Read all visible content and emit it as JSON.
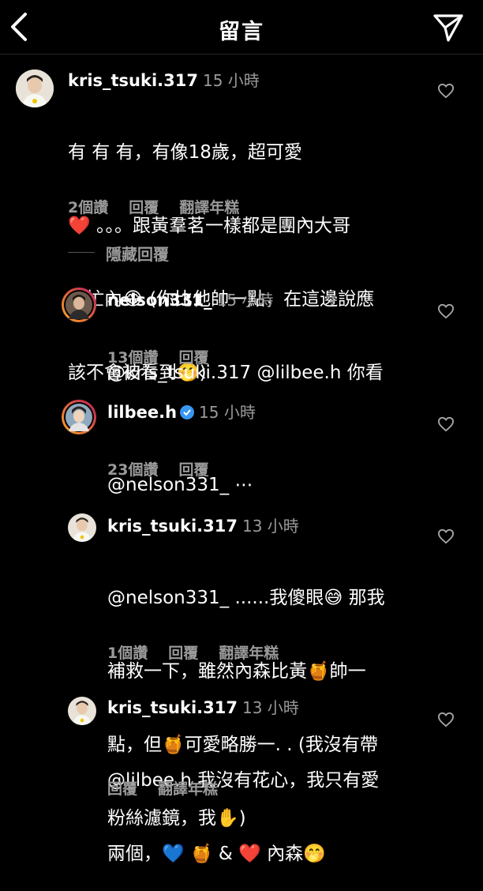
{
  "header": {
    "title": "留言"
  },
  "comments": [
    {
      "username": "kris_tsuki.317",
      "time": "15 小時",
      "lines": [
        "有 有 有，有像18歲，超可愛",
        "❤️ 。。。跟黃羣茗一樣都是團內大哥",
        "變忙內😂 (你比他帥一點，在這邊說應",
        "該不會被看到🤭)"
      ],
      "actions": [
        "2個讚",
        "回覆",
        "翻譯年糕"
      ]
    },
    {
      "username": "nelson331_",
      "time": "15 小時",
      "lines": [
        "@kris_tsuki.317 @lilbee.h 你看"
      ],
      "actions": [
        "13個讚",
        "回覆"
      ]
    },
    {
      "username": "lilbee.h",
      "time": "15 小時",
      "verified": true,
      "lines": [
        "@nelson331_ ⋯"
      ],
      "actions": [
        "23個讚",
        "回覆"
      ]
    },
    {
      "username": "kris_tsuki.317",
      "time": "13 小時",
      "lines": [
        "@nelson331_ ......我傻眼😅 那我",
        "補救一下，雖然內森比黃🍯帥一",
        "點，但🍯可愛略勝一. . (我沒有帶",
        "粉絲濾鏡，我✋)"
      ],
      "actions": [
        "1個讚",
        "回覆",
        "翻譯年糕"
      ]
    },
    {
      "username": "kris_tsuki.317",
      "time": "13 小時",
      "lines": [
        "@lilbee.h 我沒有花心，我只有愛",
        "兩個，💙 🍯 & ❤️ 內森🤭"
      ],
      "actions": [
        "回覆",
        "翻譯年糕"
      ]
    }
  ],
  "hidden_replies": "隱藏回覆",
  "colors": {
    "background": "#000000",
    "secondary_text": "#9a9a9a",
    "verified": "#3897f0",
    "story_ring_start": "#f9a825",
    "story_ring_end": "#c2185b"
  },
  "icons": [
    "chevron-left-icon",
    "send-icon",
    "heart-outline-icon",
    "verified-badge-icon"
  ]
}
